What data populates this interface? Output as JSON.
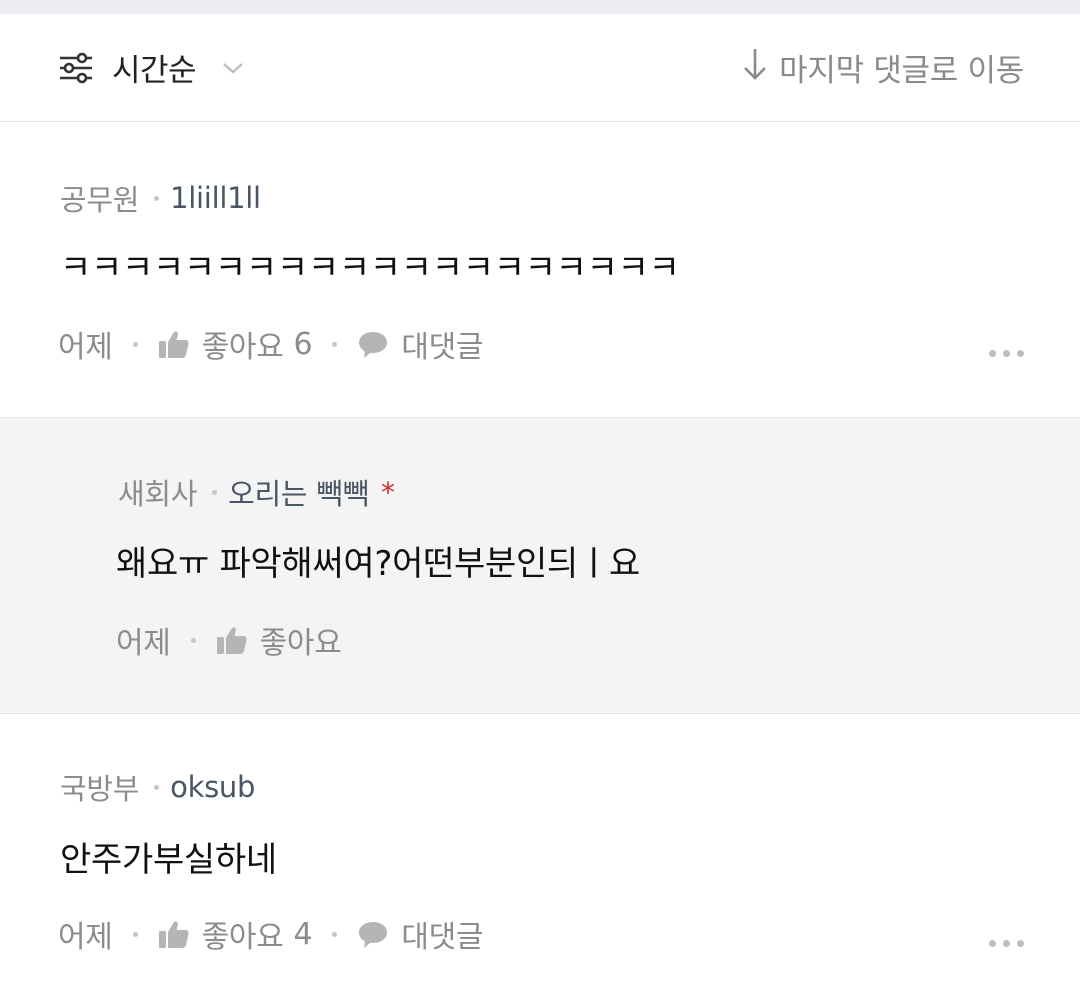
{
  "sort_bar": {
    "sort_label": "시간순",
    "jump_label": "마지막 댓글로 이동"
  },
  "comments": [
    {
      "affiliation": "공무원",
      "nickname": "1liill1ll",
      "text": "ㅋㅋㅋㅋㅋㅋㅋㅋㅋㅋㅋㅋㅋㅋㅋㅋㅋㅋㅋㅋ",
      "time": "어제",
      "like_label": "좋아요",
      "like_count": "6",
      "reply_label": "대댓글"
    },
    {
      "affiliation": "새회사",
      "nickname": "오리는 빽빽",
      "author_mark": "*",
      "text": "왜요ㅠ 파악해써여?어떤부분인듸ㅣ요",
      "time": "어제",
      "like_label": "좋아요"
    },
    {
      "affiliation": "국방부",
      "nickname": "oksub",
      "text": "안주가부실하네",
      "time": "어제",
      "like_label": "좋아요",
      "like_count": "4",
      "reply_label": "대댓글"
    }
  ],
  "colors": {
    "top_strip": "#eceef1",
    "reply_bg": "#f4f4f4",
    "nickname": "#4a5566",
    "author_mark": "#d0312d",
    "muted": "#8c8c8c"
  },
  "icons": [
    "filter-sliders-icon",
    "chevron-down-icon",
    "arrow-down-icon",
    "thumbs-up-icon",
    "speech-bubble-icon",
    "more-dots-icon"
  ]
}
